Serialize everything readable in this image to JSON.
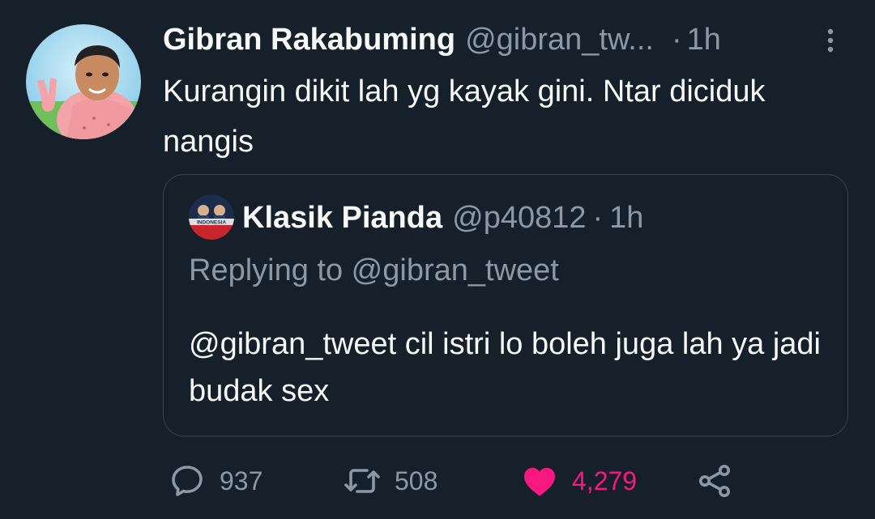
{
  "tweet": {
    "author_name": "Gibran Rakabuming",
    "author_handle": "@gibran_tw...",
    "separator": "·",
    "time": "1h",
    "text": "Kurangin dikit lah yg kayak gini. Ntar diciduk nangis",
    "avatar_icon": "user-avatar-icon",
    "more_icon": "more-vertical-icon"
  },
  "quoted": {
    "author_name": "Klasik Pianda",
    "author_handle": "@p40812",
    "separator": "·",
    "time": "1h",
    "avatar_text": "INDONESIA",
    "replying_to": "Replying to @gibran_tweet",
    "text": "@gibran_tweet cil istri lo boleh juga lah ya jadi budak sex"
  },
  "actions": {
    "reply_count": "937",
    "retweet_count": "508",
    "like_count": "4,279",
    "reply_icon": "reply-icon",
    "retweet_icon": "retweet-icon",
    "like_icon": "heart-icon",
    "share_icon": "share-icon"
  },
  "colors": {
    "background": "#15202b",
    "text": "#f7f9f9",
    "secondary": "#8b98a5",
    "border": "#38444d",
    "like": "#f91880"
  }
}
